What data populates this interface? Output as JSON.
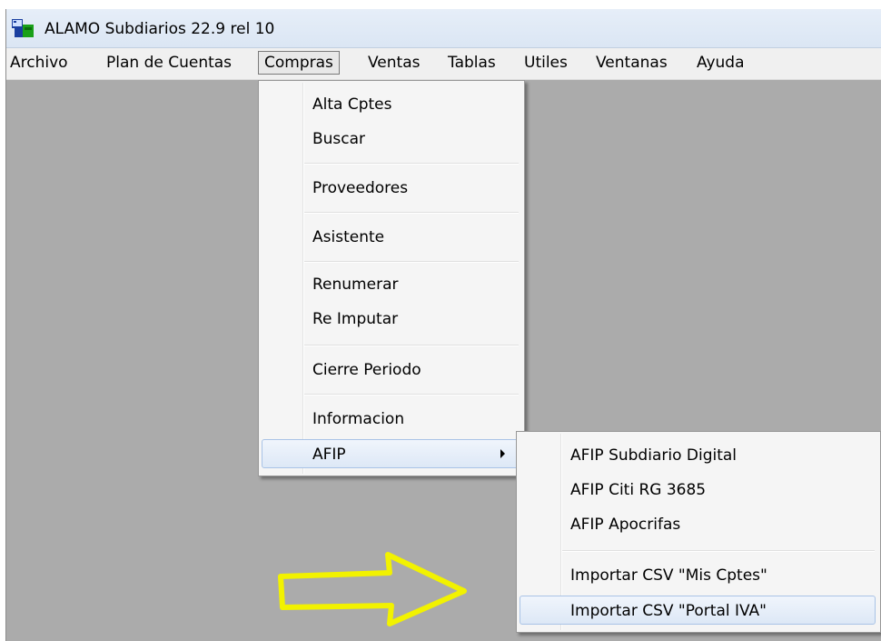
{
  "window": {
    "title": "ALAMO Subdiarios 22.9 rel 10",
    "icon": "alamo-app-icon"
  },
  "menubar": {
    "items": [
      {
        "label": "Archivo"
      },
      {
        "label": "Plan de Cuentas"
      },
      {
        "label": "Compras",
        "open": true
      },
      {
        "label": "Ventas"
      },
      {
        "label": "Tablas"
      },
      {
        "label": "Utiles"
      },
      {
        "label": "Ventanas"
      },
      {
        "label": "Ayuda"
      }
    ]
  },
  "compras_menu": {
    "items": [
      {
        "label": "Alta Cptes"
      },
      {
        "label": "Buscar"
      },
      {
        "label": "Proveedores"
      },
      {
        "label": "Asistente"
      },
      {
        "label": "Renumerar"
      },
      {
        "label": "Re Imputar"
      },
      {
        "label": "Cierre Periodo"
      },
      {
        "label": "Informacion"
      },
      {
        "label": "AFIP",
        "submenu": true,
        "highlighted": true
      }
    ]
  },
  "afip_submenu": {
    "items": [
      {
        "label": "AFIP Subdiario Digital"
      },
      {
        "label": "AFIP Citi RG 3685"
      },
      {
        "label": "AFIP Apocrifas"
      },
      {
        "label": "Importar CSV \"Mis Cptes\""
      },
      {
        "label": "Importar CSV \"Portal IVA\"",
        "highlighted": true
      }
    ]
  },
  "annotation": {
    "arrow_icon": "yellow-outline-arrow-icon",
    "arrow_color": "#f2f200"
  },
  "colors": {
    "workspace": "#ababab",
    "menu_bg": "#f5f5f5",
    "highlight_border": "#a9c3e6"
  }
}
